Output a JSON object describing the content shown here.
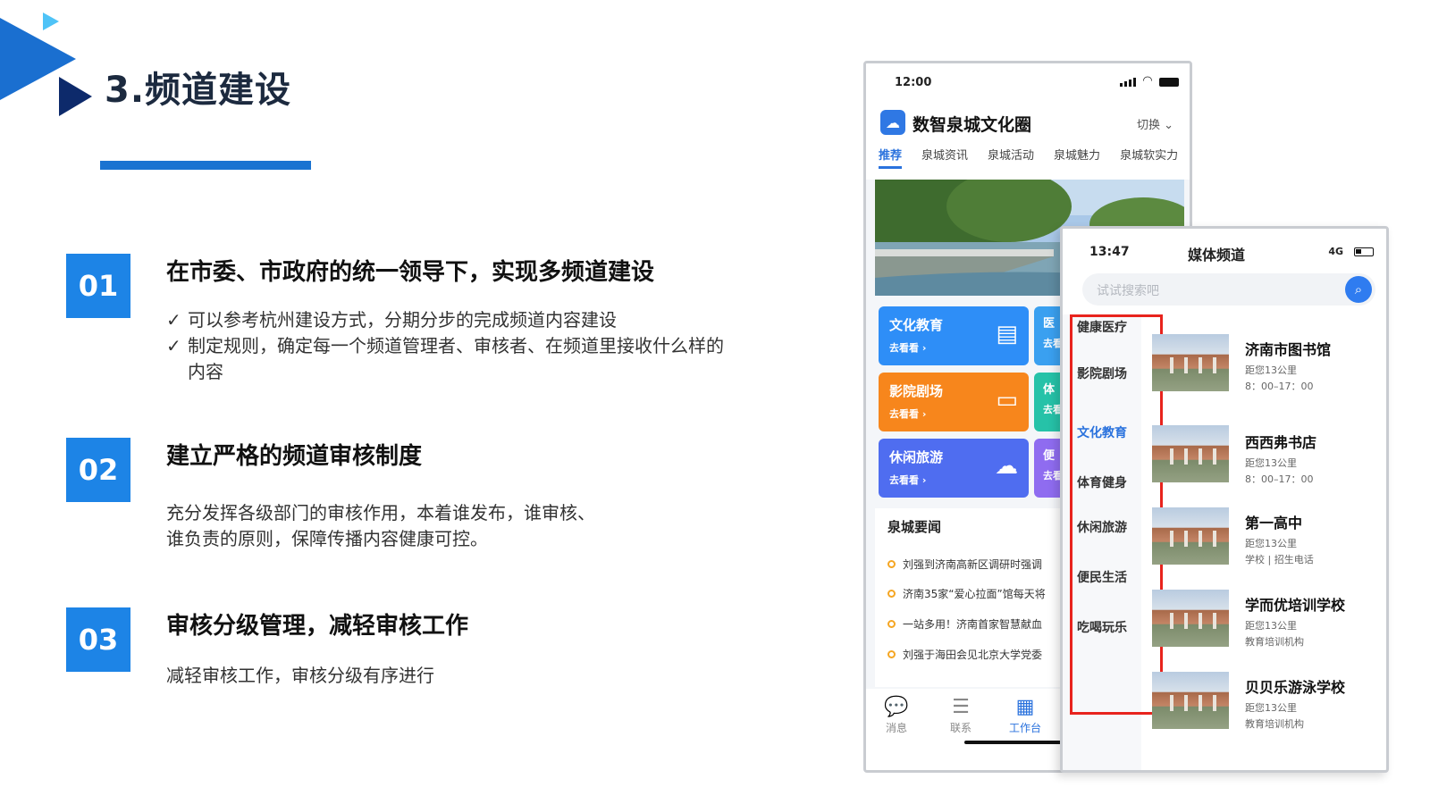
{
  "slide": {
    "title": "3.频道建设",
    "points": [
      {
        "num": "01",
        "heading": "在市委、市政府的统一领导下，实现多频道建设",
        "bullets": [
          "可以参考杭州建设方式，分期分步的完成频道内容建设",
          "制定规则，确定每一个频道管理者、审核者、在频道里接收什么样的内容"
        ]
      },
      {
        "num": "02",
        "heading": "建立严格的频道审核制度",
        "body_lines": [
          "充分发挥各级部门的审核作用，本着谁发布，谁审核、",
          "谁负责的原则，保障传播内容健康可控。"
        ]
      },
      {
        "num": "03",
        "heading": "审核分级管理，减轻审核工作",
        "body": "减轻审核工作，审核分级有序进行"
      }
    ]
  },
  "phone1": {
    "status_time": "12:00",
    "app_name": "数智泉城文化圈",
    "switch_label": "切换 ⌄",
    "tabs": [
      "推荐",
      "泉城资讯",
      "泉城活动",
      "泉城魅力",
      "泉城软实力"
    ],
    "tiles": [
      {
        "title": "文化教育",
        "sub": "去看看 ›",
        "icon": "document-icon",
        "color": "#2e8ef7",
        "peek": "医",
        "peek_sub": "去看"
      },
      {
        "title": "影院剧场",
        "sub": "去看看 ›",
        "icon": "screen-icon",
        "color": "#f7861c",
        "peek": "体",
        "peek_sub": "去看"
      },
      {
        "title": "休闲旅游",
        "sub": "去看看 ›",
        "icon": "cloud-icon",
        "color": "#4f6df0",
        "peek": "便",
        "peek_sub": "去看"
      }
    ],
    "news_title": "泉城要闻",
    "news": [
      "刘强到济南高新区调研时强调",
      "济南35家“爱心拉面”馆每天将",
      "一站多用！济南首家智慧献血",
      "刘强于海田会见北京大学党委"
    ],
    "nav": [
      {
        "label": "消息",
        "icon": "chat-icon",
        "active": false
      },
      {
        "label": "联系",
        "icon": "contacts-icon",
        "active": false
      },
      {
        "label": "工作台",
        "icon": "grid-icon",
        "active": true
      }
    ]
  },
  "phone2": {
    "status_time": "13:47",
    "title": "媒体频道",
    "network": "4G",
    "search_placeholder": "试试搜索吧",
    "categories": [
      "健康医疗",
      "影院剧场",
      "文化教育",
      "体育健身",
      "休闲旅游",
      "便民生活",
      "吃喝玩乐"
    ],
    "active_category": "文化教育",
    "items": [
      {
        "name": "济南市图书馆",
        "line1": "距您13公里",
        "line2": "8：00–17：00"
      },
      {
        "name": "西西弗书店",
        "line1": "距您13公里",
        "line2": "8：00–17：00"
      },
      {
        "name": "第一高中",
        "line1": "距您13公里",
        "line2": "学校 | 招生电话"
      },
      {
        "name": "学而优培训学校",
        "line1": "距您13公里",
        "line2": "教育培训机构"
      },
      {
        "name": "贝贝乐游泳学校",
        "line1": "距您13公里",
        "line2": "教育培训机构"
      }
    ]
  },
  "colors": {
    "accent": "#1d84e6",
    "title_dark": "#1c2a3f",
    "highlight_red": "#e8231d",
    "deco_navy": "#0d2a6b",
    "deco_blue": "#1a6fd0",
    "deco_cyan": "#4fc3f7"
  }
}
